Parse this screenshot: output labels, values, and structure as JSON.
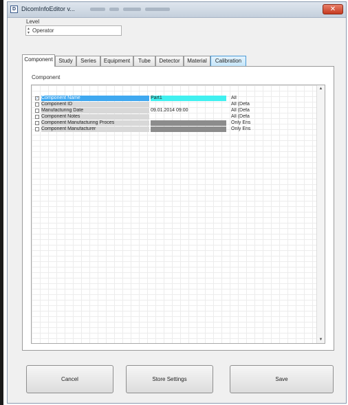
{
  "window": {
    "title": "DicomInfoEditor v...",
    "close_glyph": "✕"
  },
  "level": {
    "label": "Level",
    "value": "Operator"
  },
  "tabs": [
    {
      "label": "Component"
    },
    {
      "label": "Study"
    },
    {
      "label": "Series"
    },
    {
      "label": "Equipment"
    },
    {
      "label": "Tube"
    },
    {
      "label": "Detector"
    },
    {
      "label": "Material"
    },
    {
      "label": "Calibration"
    }
  ],
  "panel": {
    "label": "Component"
  },
  "table": {
    "rows": [
      {
        "name": "Component Name",
        "value": "Part1",
        "mode": "All",
        "checked": true
      },
      {
        "name": "Component ID",
        "value": "",
        "mode": "All (Defa",
        "checked": false
      },
      {
        "name": "Manufacturing Date",
        "value": "09.01.2014 09:00",
        "mode": "All (Defa",
        "checked": false
      },
      {
        "name": "Component Notes",
        "value": "",
        "mode": "All (Defa",
        "checked": false
      },
      {
        "name": "Component Manufacturing Proces",
        "value": "",
        "mode": "Only Ens",
        "checked": false
      },
      {
        "name": "Component Manufacturer",
        "value": "",
        "mode": "Only Ens",
        "checked": false
      }
    ]
  },
  "buttons": {
    "cancel": "Cancel",
    "store_settings": "Store Settings",
    "save": "Save"
  },
  "colors": {
    "selected_row": "#3fa8f0",
    "value_highlight": "#40f0f0",
    "disabled_value": "#8c8c8c",
    "active_tab_border": "#4b9ad6"
  }
}
